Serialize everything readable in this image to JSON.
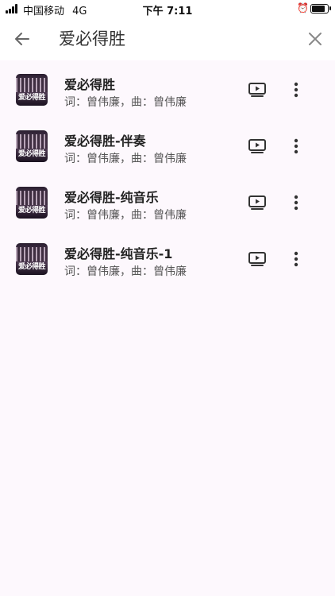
{
  "status_bar": {
    "carrier": "中国移动",
    "network": "4G",
    "time": "下午 7:11"
  },
  "search": {
    "query": "爱必得胜"
  },
  "icons": {
    "back": "arrow-left-icon",
    "clear": "close-icon",
    "video": "video-play-icon",
    "more": "more-vertical-icon"
  },
  "thumbnail_text": "爱必得胜",
  "results": [
    {
      "title": "爱必得胜",
      "subtitle": "词：曾伟廉，曲：曾伟廉"
    },
    {
      "title": "爱必得胜-伴奏",
      "subtitle": "词：曾伟廉，曲：曾伟廉"
    },
    {
      "title": "爱必得胜-纯音乐",
      "subtitle": "词：曾伟廉，曲：曾伟廉"
    },
    {
      "title": "爱必得胜-纯音乐-1",
      "subtitle": "词：曾伟廉，曲：曾伟廉"
    }
  ]
}
